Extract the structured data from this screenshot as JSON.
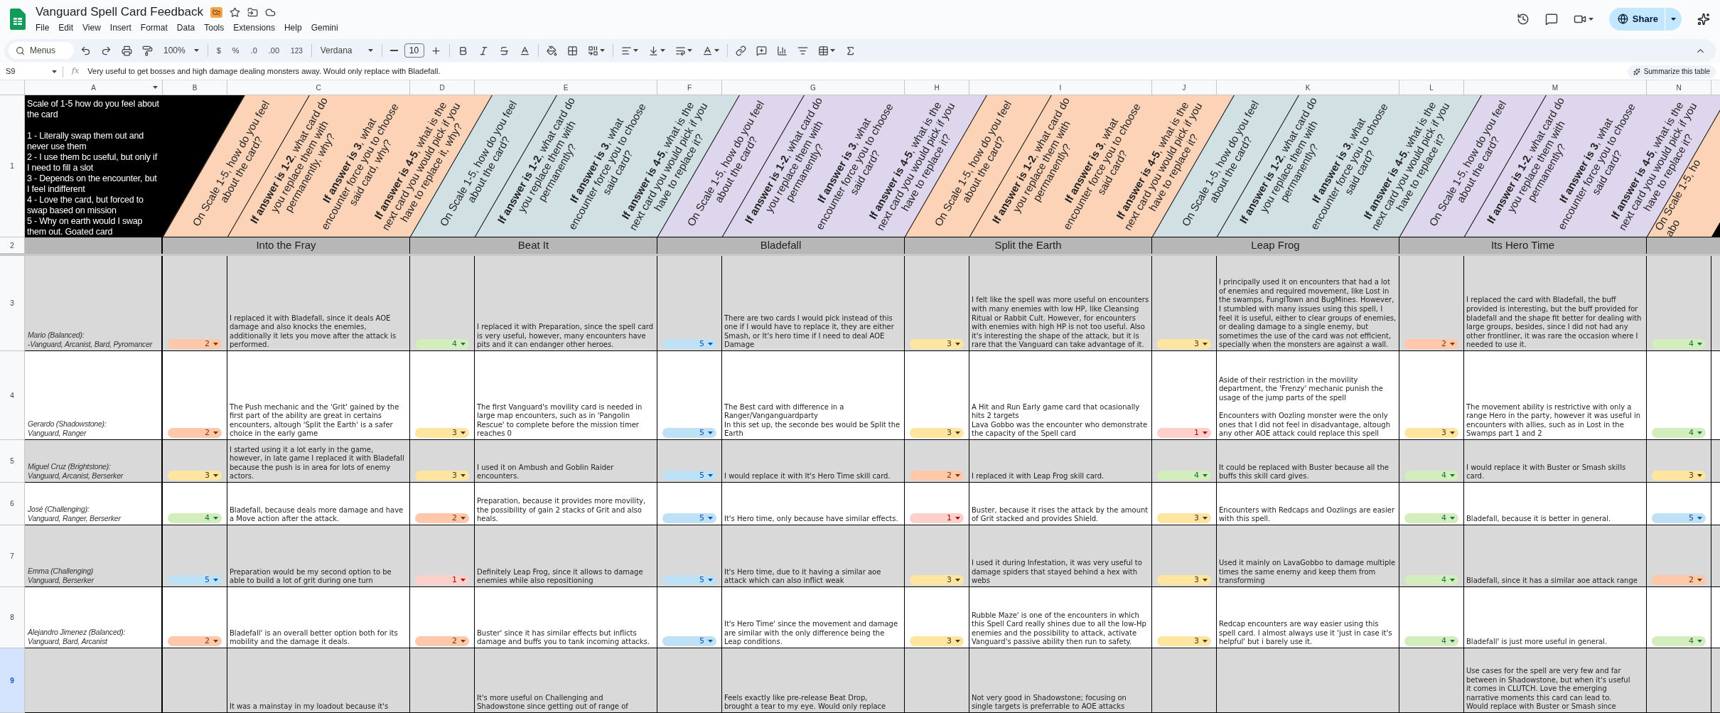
{
  "window": {
    "title": "Vanguard Spell Card Feedback",
    "menu": [
      "File",
      "Edit",
      "View",
      "Insert",
      "Format",
      "Data",
      "Tools",
      "Extensions",
      "Help",
      "Gemini"
    ],
    "share_button": "Share"
  },
  "toolbar": {
    "search_placeholder": "Menus",
    "zoom": "100%",
    "currency": "$",
    "percent": "%",
    "decrease_decimals": ".0",
    "increase_decimals": ".00",
    "number_format": "123",
    "font": "Verdana",
    "font_size": "10"
  },
  "formula_bar": {
    "cell": "S9",
    "function_label": "fx",
    "formula": "Very useful to get bosses and high damage dealing monsters away. Would only replace with Bladefall.",
    "summarize_button": "Summarize this table"
  },
  "columns": [
    "A",
    "B",
    "C",
    "D",
    "E",
    "F",
    "G",
    "H",
    "I",
    "J",
    "K",
    "L",
    "M",
    "N"
  ],
  "row_numbers": [
    {
      "label": "1",
      "selected": false
    },
    {
      "label": "2",
      "selected": false
    },
    {
      "label": "3",
      "selected": false
    },
    {
      "label": "4",
      "selected": false
    },
    {
      "label": "5",
      "selected": false
    },
    {
      "label": "6",
      "selected": false
    },
    {
      "label": "7",
      "selected": false
    },
    {
      "label": "8",
      "selected": false
    },
    {
      "label": "9",
      "selected": true
    }
  ],
  "legend": "Scale of 1-5 how do you feel about the card\n\n1 - Literally swap them out and never use them\n2 - I use them bc useful, but only if I need to fill a slot\n3 - Depends on the encounter, but I feel indifferent\n4 - Love the card, but forced to swap based on mission\n5 - Why on earth would I swap them out. Goated card",
  "cards": [
    {
      "name": "Into the Fray",
      "color": "#fdd3b8",
      "rating_question": {
        "lines": [
          "On Scale 1-5, how do you feel",
          "about the card?"
        ]
      },
      "comment_questions": [
        {
          "lines": [
            "**If answer is 1-2**, what card do",
            "you replace them with",
            "permanently, why?"
          ]
        },
        {
          "lines": [
            "**If answer is 3**, what",
            "encounter force you to choose",
            "said card, why?"
          ]
        },
        {
          "lines": [
            "**If answer is 4-5**, what is the",
            "next card you would pick if you",
            "have to replace it, why?"
          ]
        }
      ]
    },
    {
      "name": "Beat It",
      "color": "#d0e0e3",
      "rating_question": {
        "lines": [
          "On Scale 1-5, how do you feel",
          "about the card?"
        ]
      },
      "comment_questions": [
        {
          "lines": [
            "**If answer is 1-2**, what card do",
            "you replace them with",
            "permanently?"
          ]
        },
        {
          "lines": [
            "**If answer is 3**, what",
            "encounter force you to choose",
            "said card?"
          ]
        },
        {
          "lines": [
            "**If answer is 4-5**, what is the",
            "next card you would pick if you",
            "have to replace it?"
          ]
        }
      ]
    },
    {
      "name": "Bladefall",
      "color": "#ddd6ec",
      "rating_question": {
        "lines": [
          "On Scale 1-5, how do you feel",
          "about the card?"
        ]
      },
      "comment_questions": [
        {
          "lines": [
            "**If answer is 1-2**, what card do",
            "you replace them with",
            "permanently?"
          ]
        },
        {
          "lines": [
            "**If answer is 3**, what",
            "encounter force you to choose",
            "said card?"
          ]
        },
        {
          "lines": [
            "**If answer is 4-5**, what is the",
            "next card you would pick if you",
            "have to replace it?"
          ]
        }
      ]
    },
    {
      "name": "Split the Earth",
      "color": "#fdd3b8",
      "rating_question": {
        "lines": [
          "On Scale 1-5, how do you feel",
          "about the card?"
        ]
      },
      "comment_questions": [
        {
          "lines": [
            "**If answer is 1-2**, what card do",
            "you replace them with",
            "permanently?"
          ]
        },
        {
          "lines": [
            "**If answer is 3**, what",
            "encounter force you to choose",
            "said card?"
          ]
        },
        {
          "lines": [
            "**If answer is 4-5**, what is the",
            "next card you would pick if you",
            "have to replace it?"
          ]
        }
      ]
    },
    {
      "name": "Leap Frog",
      "color": "#d0e0e3",
      "rating_question": {
        "lines": [
          "On Scale 1-5, how do you feel",
          "about the card?"
        ]
      },
      "comment_questions": [
        {
          "lines": [
            "**If answer is 1-2**, what card do",
            "you replace them with",
            "permanently?"
          ]
        },
        {
          "lines": [
            "**If answer is 3**, what",
            "encounter force you to choose",
            "said card?"
          ]
        },
        {
          "lines": [
            "**If answer is 4-5**, what is the",
            "next card you would pick if you",
            "have to replace it?"
          ]
        }
      ]
    },
    {
      "name": "Its Hero Time",
      "color": "#ddd6ec",
      "rating_question": {
        "lines": [
          "On Scale 1-5, how do you feel",
          "about the card?"
        ]
      },
      "comment_questions": [
        {
          "lines": [
            "**If answer is 1-2**, what card do",
            "you replace them with",
            "permanently?"
          ]
        },
        {
          "lines": [
            "**If answer is 3**, what",
            "encounter force you to choose",
            "said card?"
          ]
        },
        {
          "lines": [
            "**If answer is 4-5**, what is the",
            "next card you would pick if you",
            "have to replace it?"
          ]
        }
      ]
    },
    {
      "color": "#fdd3b8",
      "rating_question": {
        "lines": [
          "On Scale 1-5, ho",
          "abo"
        ]
      }
    }
  ],
  "rows": [
    {
      "player": "Mario (Balanced):\n-Vanguard, Arcanist, Bard, Pyromancer",
      "entries": [
        {
          "rating": {
            "value": "2",
            "color": "#ffc8aa"
          },
          "comment": "I replaced it with Bladefall, since it deals AOE damage and also knocks the enemies, additionally it lets you move after the attack is performed."
        },
        {
          "rating": {
            "value": "4",
            "color": "#d4edbc"
          },
          "comment": "I replaced it with Preparation, since the spell card is very useful, however, many encounters have pits and it can endanger other heroes."
        },
        {
          "rating": {
            "value": "5",
            "color": "#bfe1f6"
          },
          "comment": "There are two cards I would pick instead of this one if I would have to replace it, they are either Smash, or It's hero time if I need to deal AOE Damage"
        },
        {
          "rating": {
            "value": "3",
            "color": "#ffe5a0"
          },
          "comment": "I felt like the spell was more useful on encounters with many enemies with low HP, like Cleansing Ritual or Rabbit Cult. However, for encounters with enemies with high HP is not too useful. Also it's interesting the shape of the attack, but it is rare that the Vanguard can take advantage of it."
        },
        {
          "rating": {
            "value": "3",
            "color": "#ffe5a0"
          },
          "comment": "I principally used it on encounters that had a lot of enemies and required movement, like Lost in the swamps, FungiTown and BugMines. However, I stumbled with many issues using this spell, I feel it is useful, either to clear groups of enemies, or dealing damage to a single enemy, but sometimes the use of the card was not efficient, specially when the monsters are against a wall."
        },
        {
          "rating": {
            "value": "2",
            "color": "#ffc8aa"
          },
          "comment": "I replaced the card with Bladefall, the buff provided is interesting, but the buff provided for bladefall and the shape fit better for dealing with large groups, besides, since I did not had any other frontliner, it was rare the occasion where I needed to use it."
        },
        {
          "rating": {
            "value": "4",
            "color": "#d4edbc"
          }
        }
      ]
    },
    {
      "player": "Gerardo (Shadowstone):\nVanguard, Ranger",
      "entries": [
        {
          "rating": {
            "value": "2",
            "color": "#ffc8aa"
          },
          "comment": "The Push mechanic and the 'Grit' gained by the first part of the ability are great in certains encounters, altough 'Split the Earth' is a safer choice in the early game"
        },
        {
          "rating": {
            "value": "3",
            "color": "#ffe5a0"
          },
          "comment": "The first Vanguard's movility card is needed in large map encounters, such as in 'Pangolin Rescue' to complete before the mission timer reaches 0"
        },
        {
          "rating": {
            "value": "5",
            "color": "#bfe1f6"
          },
          "comment": "The Best card with difference in a Ranger/Vanganguardparty\nIn this set up, the seconde bes would be Split the Earth"
        },
        {
          "rating": {
            "value": "3",
            "color": "#ffe5a0"
          },
          "comment": "A Hit and Run Early game card that ocasionally hits 2 targets\nLava Gobbo was the encounter who demonstrate the capacity of the Spell card"
        },
        {
          "rating": {
            "value": "1",
            "color": "#ffcfc9"
          },
          "comment": "Aside of their restriction in the movility department, the 'Frenzy' mechanic punish the usage of the jump parts of the spell\n\nEncounters with Oozling monster were the only ones that I did not feel in disadvantage, altough any other AOE attack could replace this spell"
        },
        {
          "rating": {
            "value": "3",
            "color": "#ffe5a0"
          },
          "comment": "The movement ability is restrictive with only a range Hero in the party, however it was useful in encounters with allies, such as in Lost in the Swamps part 1 and 2"
        },
        {
          "rating": {
            "value": "4",
            "color": "#d4edbc"
          }
        }
      ]
    },
    {
      "player": "Miguel Cruz (Brightstone):\nVanguard, Arcanist, Berserker",
      "entries": [
        {
          "rating": {
            "value": "3",
            "color": "#ffe5a0"
          },
          "comment": "I started using it a lot early in the game, however, in late game I replaced it with Bladefall because the push is in area for lots of enemy actors."
        },
        {
          "rating": {
            "value": "3",
            "color": "#ffe5a0"
          },
          "comment": "I used it on Ambush and Goblin Raider encounters."
        },
        {
          "rating": {
            "value": "5",
            "color": "#bfe1f6"
          },
          "comment": "I would replace it with It's Hero Time skill card."
        },
        {
          "rating": {
            "value": "2",
            "color": "#ffc8aa"
          },
          "comment": "I replaced it with Leap Frog skill card."
        },
        {
          "rating": {
            "value": "4",
            "color": "#d4edbc"
          },
          "comment": "It could be replaced with Buster because all the buffs this skill card gives."
        },
        {
          "rating": {
            "value": "4",
            "color": "#d4edbc"
          },
          "comment": "I would replace it with Buster or Smash skills card."
        },
        {
          "rating": {
            "value": "3",
            "color": "#ffe5a0"
          }
        }
      ]
    },
    {
      "player": "José (Challenging):\nVanguard, Ranger, Berserker",
      "entries": [
        {
          "rating": {
            "value": "4",
            "color": "#d4edbc"
          },
          "comment": "Bladefall, because deals more damage and have a Move action after the attack."
        },
        {
          "rating": {
            "value": "2",
            "color": "#ffc8aa"
          },
          "comment": "Preparation, because it provides more movility, the possibility of gain 2 stacks of Grit and also heals."
        },
        {
          "rating": {
            "value": "5",
            "color": "#bfe1f6"
          },
          "comment": "It's Hero time, only because have similar effects."
        },
        {
          "rating": {
            "value": "1",
            "color": "#ffcfc9"
          },
          "comment": "Buster, because it rises the attack by the amount of Grit stacked and provides Shield."
        },
        {
          "rating": {
            "value": "3",
            "color": "#ffe5a0"
          },
          "comment": "Encounters with Redcaps and Oozlings are easier with this spell."
        },
        {
          "rating": {
            "value": "4",
            "color": "#d4edbc"
          },
          "comment": "Bladefall, because it is better in general."
        },
        {
          "rating": {
            "value": "5",
            "color": "#bfe1f6"
          }
        }
      ]
    },
    {
      "player": "Emma (Challenging)\nVanguard, Berserker",
      "entries": [
        {
          "rating": {
            "value": "5",
            "color": "#bfe1f6"
          },
          "comment": "Preparation would be my second option to be able to build a lot of grit during one turn"
        },
        {
          "rating": {
            "value": "1",
            "color": "#ffcfc9"
          },
          "comment": "Definitely Leap Frog, since it allows to damage enemies while also repositioning"
        },
        {
          "rating": {
            "value": "5",
            "color": "#bfe1f6"
          },
          "comment": "It's Hero time, due to it having a similar aoe attack which can also inflict weak"
        },
        {
          "rating": {
            "value": "3",
            "color": "#ffe5a0"
          },
          "comment": "I used it during Infestation, it was very useful to damage spiders that stayed behind a hex with webs"
        },
        {
          "rating": {
            "value": "3",
            "color": "#ffe5a0"
          },
          "comment": "Used it mainly on LavaGobbo to damage multiple times the same enemy and keep them from transforming"
        },
        {
          "rating": {
            "value": "4",
            "color": "#d4edbc"
          },
          "comment": "Bladefall, since it has a similar aoe attack range"
        },
        {
          "rating": {
            "value": "2",
            "color": "#ffc8aa"
          }
        }
      ]
    },
    {
      "player": "Alejandro Jimenez (Balanced):\nVanguard, Bard, Arcanist",
      "entries": [
        {
          "rating": {
            "value": "2",
            "color": "#ffc8aa"
          },
          "comment": "Bladefall' is an overall better option both for its mobility and the damage it deals."
        },
        {
          "rating": {
            "value": "2",
            "color": "#ffc8aa"
          },
          "comment": "Buster' since it has similar effects but inflicts damage and buffs you to tank incoming attacks."
        },
        {
          "rating": {
            "value": "5",
            "color": "#bfe1f6"
          },
          "comment": "It's Hero Time' since the movement and damage are similar with the only difference being the Leap conditions."
        },
        {
          "rating": {
            "value": "3",
            "color": "#ffe5a0"
          },
          "comment": "Rubble Maze' is one of the encounters in which this Spell Card really shines due to all the low-Hp enemies and the possibility to attack, activate Vanguard's passive ability then run to safety."
        },
        {
          "rating": {
            "value": "3",
            "color": "#ffe5a0"
          },
          "comment": "Redcap encounters are way easier using this spell card. I almost always use it 'just in case it's helpful' but i barely use it."
        },
        {
          "rating": {
            "value": "4",
            "color": "#d4edbc"
          },
          "comment": "Bladefall' is just more useful in general."
        },
        {
          "rating": {
            "value": "4",
            "color": "#d4edbc"
          }
        }
      ]
    },
    {
      "cells": [
        {
          "kind": "blank"
        },
        {
          "kind": "comment",
          "text": "It was a mainstay in my loadout because it's"
        },
        {
          "kind": "blank"
        },
        {
          "kind": "comment",
          "text": "It's more useful on Challenging and\nShadowstone since getting out of range of"
        },
        {
          "kind": "blank"
        },
        {
          "kind": "comment",
          "text": "Feels exactly like pre-release Beat Drop,\nbrought a tear to my eye. Would only replace"
        },
        {
          "kind": "blank"
        },
        {
          "kind": "comment",
          "text": "Not very good in Shadowstone; focusing on\nsingle targets is preferrable to AOE attacks"
        },
        {
          "kind": "blank"
        },
        {
          "kind": "blank"
        },
        {
          "kind": "blank"
        },
        {
          "kind": "comment",
          "text": "Use cases for the spell are very few and far\nbetween in Shadowstone, but when it's useful\nit comes in CLUTCH. Love the emerging\nnarrative moments this card can lead to.\nWould replace with Buster or Smash since"
        },
        {
          "kind": "blank"
        }
      ]
    }
  ]
}
